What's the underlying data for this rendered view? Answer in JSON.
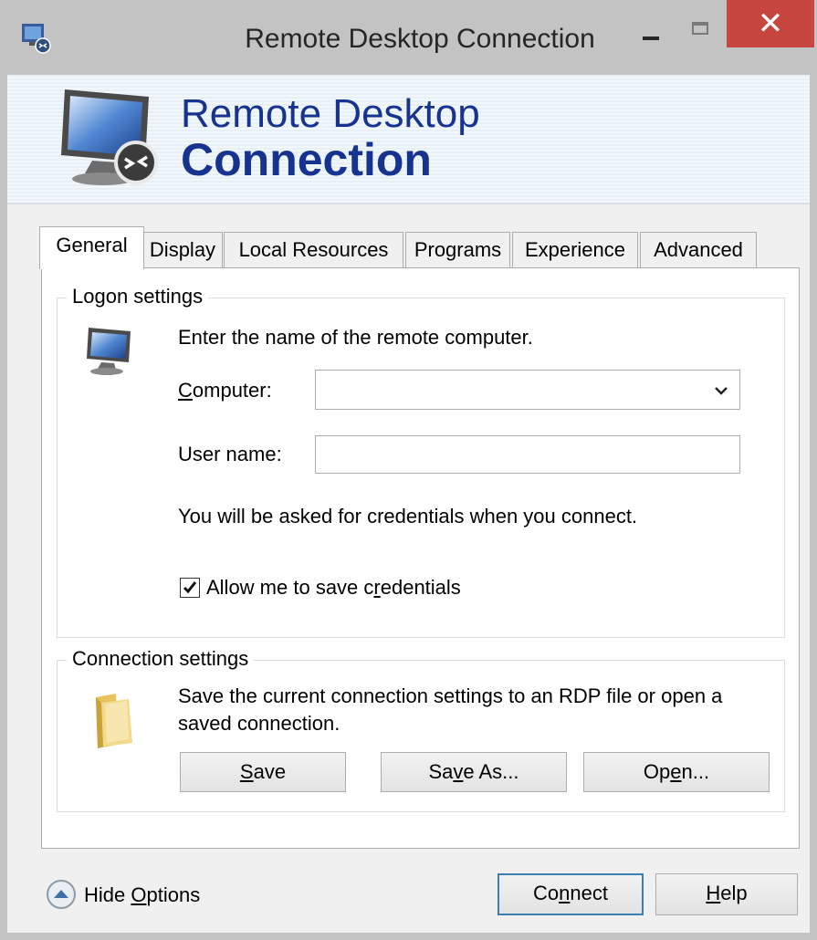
{
  "window": {
    "title": "Remote Desktop Connection",
    "close_glyph": "✕"
  },
  "banner": {
    "line1": "Remote Desktop",
    "line2": "Connection"
  },
  "tabs": [
    {
      "label": "General",
      "active": true
    },
    {
      "label": "Display"
    },
    {
      "label": "Local Resources"
    },
    {
      "label": "Programs"
    },
    {
      "label": "Experience"
    },
    {
      "label": "Advanced"
    }
  ],
  "logon": {
    "title": "Logon settings",
    "instruction": "Enter the name of the remote computer.",
    "computer_label_accel": "C",
    "computer_label_rest": "omputer:",
    "computer_value": "",
    "username_label": "User name:",
    "username_value": "",
    "credentials_note": "You will be asked for credentials when you connect.",
    "save_credentials_pre": "Allow me to save c",
    "save_credentials_accel": "r",
    "save_credentials_post": "edentials",
    "save_credentials_checked": true
  },
  "connection": {
    "title": "Connection settings",
    "description_line1": "Save the current connection settings to an RDP file or open a",
    "description_line2": "saved connection.",
    "save_accel": "S",
    "save_rest": "ave",
    "saveas_pre": "Sa",
    "saveas_accel": "v",
    "saveas_post": "e As...",
    "open_pre": "Op",
    "open_accel": "e",
    "open_post": "n..."
  },
  "footer": {
    "hide_options_pre": "Hide ",
    "hide_options_accel": "O",
    "hide_options_post": "ptions",
    "connect_pre": "Co",
    "connect_accel": "n",
    "connect_post": "nect",
    "help_accel": "H",
    "help_rest": "elp"
  },
  "colors": {
    "accent": "#16338f",
    "close": "#c7463f",
    "default_button_border": "#3c7fb1"
  }
}
